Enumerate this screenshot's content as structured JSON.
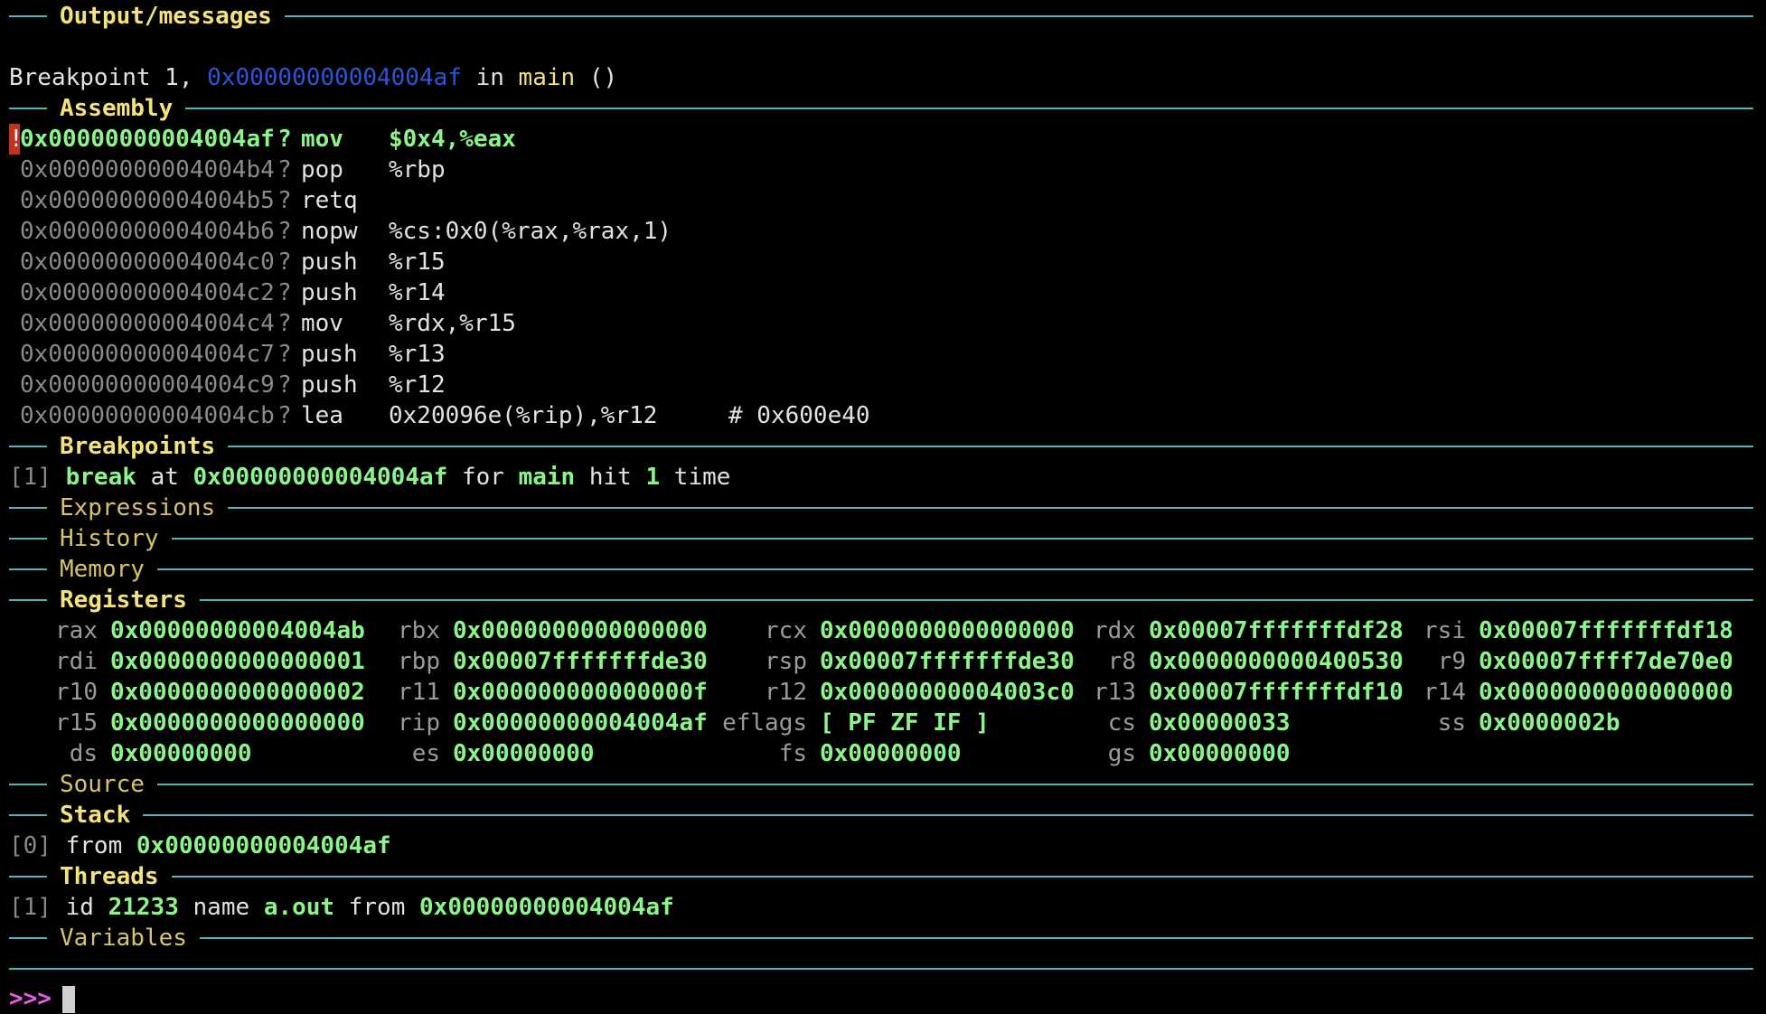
{
  "sections": {
    "output": "Output/messages",
    "assembly": "Assembly",
    "breakpoints": "Breakpoints",
    "expressions": "Expressions",
    "history": "History",
    "memory": "Memory",
    "registers": "Registers",
    "source": "Source",
    "stack": "Stack",
    "threads": "Threads",
    "variables": "Variables"
  },
  "output": {
    "prefix": "Breakpoint 1,",
    "address": "0x00000000004004af",
    "in": "in",
    "func": "main",
    "parens": "()"
  },
  "assembly": [
    {
      "addr": "0x00000000004004af",
      "mark": "!",
      "q": "?",
      "op": "mov",
      "args": "$0x4,%eax",
      "comment": ""
    },
    {
      "addr": "0x00000000004004b4",
      "mark": "",
      "q": "?",
      "op": "pop",
      "args": "%rbp",
      "comment": ""
    },
    {
      "addr": "0x00000000004004b5",
      "mark": "",
      "q": "?",
      "op": "retq",
      "args": "",
      "comment": ""
    },
    {
      "addr": "0x00000000004004b6",
      "mark": "",
      "q": "?",
      "op": "nopw",
      "args": "%cs:0x0(%rax,%rax,1)",
      "comment": ""
    },
    {
      "addr": "0x00000000004004c0",
      "mark": "",
      "q": "?",
      "op": "push",
      "args": "%r15",
      "comment": ""
    },
    {
      "addr": "0x00000000004004c2",
      "mark": "",
      "q": "?",
      "op": "push",
      "args": "%r14",
      "comment": ""
    },
    {
      "addr": "0x00000000004004c4",
      "mark": "",
      "q": "?",
      "op": "mov",
      "args": "%rdx,%r15",
      "comment": ""
    },
    {
      "addr": "0x00000000004004c7",
      "mark": "",
      "q": "?",
      "op": "push",
      "args": "%r13",
      "comment": ""
    },
    {
      "addr": "0x00000000004004c9",
      "mark": "",
      "q": "?",
      "op": "push",
      "args": "%r12",
      "comment": ""
    },
    {
      "addr": "0x00000000004004cb",
      "mark": "",
      "q": "?",
      "op": "lea",
      "args": "0x20096e(%rip),%r12",
      "comment": "# 0x600e40"
    }
  ],
  "breakpoint": {
    "index": "[1]",
    "kind": "break",
    "at": "at",
    "addr": "0x00000000004004af",
    "for": "for",
    "func": "main",
    "hit": "hit",
    "count": "1",
    "time": "time"
  },
  "registers": [
    [
      {
        "n": "rax",
        "v": "0x00000000004004ab"
      },
      {
        "n": "rbx",
        "v": "0x0000000000000000"
      },
      {
        "n": "rcx",
        "v": "0x0000000000000000"
      },
      {
        "n": "rdx",
        "v": "0x00007fffffffdf28"
      },
      {
        "n": "rsi",
        "v": "0x00007fffffffdf18"
      }
    ],
    [
      {
        "n": "rdi",
        "v": "0x0000000000000001"
      },
      {
        "n": "rbp",
        "v": "0x00007fffffffde30"
      },
      {
        "n": "rsp",
        "v": "0x00007fffffffde30"
      },
      {
        "n": "r8",
        "v": "0x0000000000400530"
      },
      {
        "n": "r9",
        "v": "0x00007ffff7de70e0"
      }
    ],
    [
      {
        "n": "r10",
        "v": "0x0000000000000002"
      },
      {
        "n": "r11",
        "v": "0x000000000000000f"
      },
      {
        "n": "r12",
        "v": "0x00000000004003c0"
      },
      {
        "n": "r13",
        "v": "0x00007fffffffdf10"
      },
      {
        "n": "r14",
        "v": "0x0000000000000000"
      }
    ],
    [
      {
        "n": "r15",
        "v": "0x0000000000000000"
      },
      {
        "n": "rip",
        "v": "0x00000000004004af"
      },
      {
        "n": "eflags",
        "v": "[ PF ZF IF ]"
      },
      {
        "n": "cs",
        "v": "0x00000033"
      },
      {
        "n": "ss",
        "v": "0x0000002b"
      }
    ],
    [
      {
        "n": "ds",
        "v": "0x00000000"
      },
      {
        "n": "es",
        "v": "0x00000000"
      },
      {
        "n": "fs",
        "v": "0x00000000"
      },
      {
        "n": "gs",
        "v": "0x00000000"
      }
    ]
  ],
  "stack": {
    "index": "[0]",
    "from": "from",
    "addr": "0x00000000004004af"
  },
  "thread": {
    "index": "[1]",
    "id_label": "id",
    "id": "21233",
    "name_label": "name",
    "name": "a.out",
    "from": "from",
    "addr": "0x00000000004004af"
  },
  "prompt": ">>>",
  "colors": {
    "background": "#000000",
    "rule": "#4fb3c2",
    "title": "#f2e37b",
    "green": "#8cf58a",
    "blue_addr": "#2b56d9",
    "prompt": "#ea5bea",
    "current_marker": "#c2331c"
  }
}
